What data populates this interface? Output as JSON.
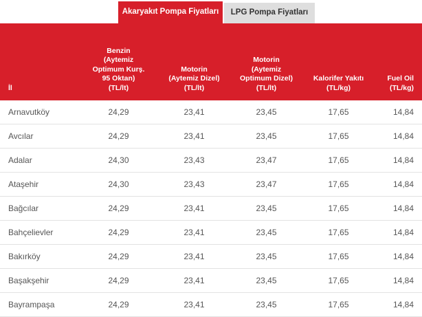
{
  "tabs": [
    {
      "label": "Akaryakıt Pompa Fiyatları",
      "active": true
    },
    {
      "label": "LPG Pompa Fiyatları",
      "active": false
    }
  ],
  "colors": {
    "accent": "#d71f2a",
    "inactive_tab": "#dedede"
  },
  "table": {
    "headers": [
      "İl",
      "Benzin\n(Aytemiz\nOptimum Kurş.\n95 Oktan)\n(TL/lt)",
      "Motorin\n(Aytemiz Dizel)\n(TL/lt)",
      "Motorin\n(Aytemiz\nOptimum Dizel)\n(TL/lt)",
      "Kalorifer Yakıtı\n(TL/kg)",
      "Fuel Oil\n(TL/kg)"
    ],
    "rows": [
      [
        "Arnavutköy",
        "24,29",
        "23,41",
        "23,45",
        "17,65",
        "14,84"
      ],
      [
        "Avcılar",
        "24,29",
        "23,41",
        "23,45",
        "17,65",
        "14,84"
      ],
      [
        "Adalar",
        "24,30",
        "23,43",
        "23,47",
        "17,65",
        "14,84"
      ],
      [
        "Ataşehir",
        "24,30",
        "23,43",
        "23,47",
        "17,65",
        "14,84"
      ],
      [
        "Bağcılar",
        "24,29",
        "23,41",
        "23,45",
        "17,65",
        "14,84"
      ],
      [
        "Bahçelievler",
        "24,29",
        "23,41",
        "23,45",
        "17,65",
        "14,84"
      ],
      [
        "Bakırköy",
        "24,29",
        "23,41",
        "23,45",
        "17,65",
        "14,84"
      ],
      [
        "Başakşehir",
        "24,29",
        "23,41",
        "23,45",
        "17,65",
        "14,84"
      ],
      [
        "Bayrampaşa",
        "24,29",
        "23,41",
        "23,45",
        "17,65",
        "14,84"
      ]
    ]
  }
}
